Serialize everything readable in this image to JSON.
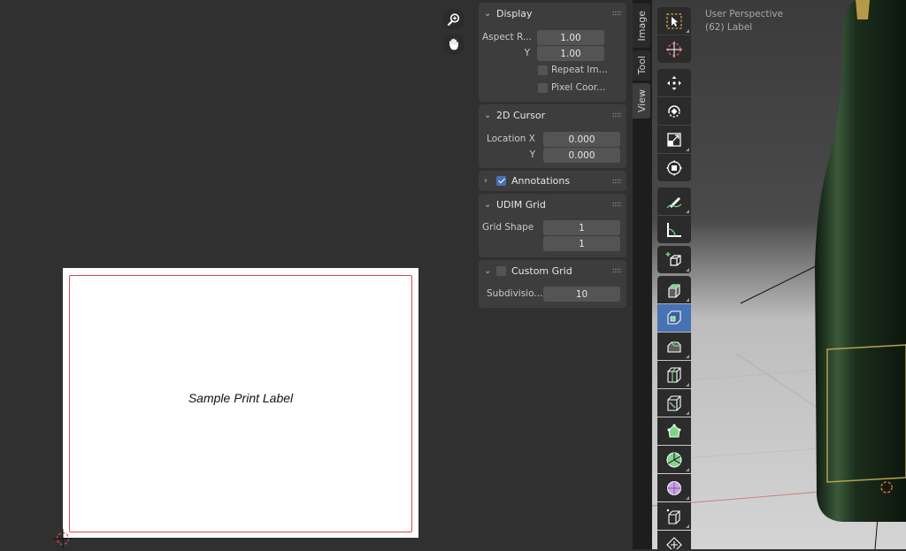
{
  "uv_editor": {
    "image_text": "Sample Print Label"
  },
  "sidebar": {
    "display": {
      "title": "Display",
      "aspect_label": "Aspect R...",
      "aspect_x": "1.00",
      "y_label": "Y",
      "aspect_y": "1.00",
      "repeat_label": "Repeat Im...",
      "pixel_coords_label": "Pixel Coor..."
    },
    "cursor2d": {
      "title": "2D Cursor",
      "location_x_label": "Location X",
      "location_x": "0.000",
      "y_label": "Y",
      "location_y": "0.000"
    },
    "annotations": {
      "title": "Annotations",
      "checked": true
    },
    "udim_grid": {
      "title": "UDIM Grid",
      "grid_shape_label": "Grid Shape",
      "shape_x": "1",
      "shape_y": "1"
    },
    "custom_grid": {
      "title": "Custom Grid",
      "checked": false,
      "subdivisions_label": "Subdivisio...",
      "subdivisions": "10"
    }
  },
  "tabs": [
    "Image",
    "Tool",
    "View"
  ],
  "active_tab": "View",
  "viewport": {
    "perspective": "User Perspective",
    "object": "(62) Label"
  },
  "toolbar_tools": [
    "select-box",
    "cursor",
    "move",
    "rotate",
    "scale",
    "transform",
    "annotate",
    "measure",
    "add-cube",
    "extrude-region",
    "inset-faces",
    "bevel",
    "loop-cut",
    "knife",
    "poly-build",
    "spin",
    "smooth",
    "edge-slide",
    "shrink-fatten"
  ],
  "colors": {
    "accent": "#4772b3",
    "label_border": "#e0464d",
    "panel_bg": "#3d3d3d",
    "field_bg": "#545454"
  }
}
